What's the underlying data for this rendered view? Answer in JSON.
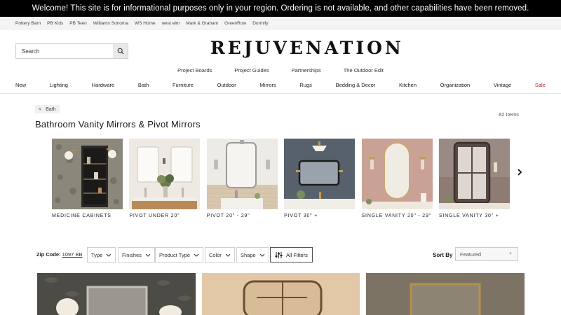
{
  "banner": {
    "text": "Welcome! This site is for informational purposes only in your region. Ordering is not available, and other capabilities have been removed."
  },
  "brands": [
    "Pottery Barn",
    "PB Kids",
    "PB Teen",
    "Williams Sonoma",
    "WS Home",
    "west elm",
    "Mark & Graham",
    "GreenRow",
    "Dormify"
  ],
  "search": {
    "placeholder": "Search",
    "icon": "search-icon"
  },
  "logo": "REJUVENATION",
  "secondary_nav": [
    "Project Boards",
    "Project Guides",
    "Partnerships",
    "The Outdoor Edit"
  ],
  "main_nav": [
    "New",
    "Lighting",
    "Hardware",
    "Bath",
    "Furniture",
    "Outdoor",
    "Mirrors",
    "Rugs",
    "Bedding & Decor",
    "Kitchen",
    "Organization",
    "Vintage",
    "Sale"
  ],
  "breadcrumb": {
    "arrow": "<",
    "label": "Bath"
  },
  "item_count": "82 Items",
  "page_title": "Bathroom Vanity Mirrors & Pivot Mirrors",
  "categories": [
    {
      "label": "MEDICINE CABINETS"
    },
    {
      "label": "PIVOT UNDER 20\""
    },
    {
      "label": "PIVOT 20\" - 29\""
    },
    {
      "label": "PIVOT 30\" +"
    },
    {
      "label": "SINGLE VANITY 20\" - 29\""
    },
    {
      "label": "SINGLE VANITY 30\" +"
    }
  ],
  "filters": {
    "zip_label": "Zip Code:",
    "zip_value": "1097 BB",
    "dropdowns": [
      "Type",
      "Finishes",
      "Product Type",
      "Color",
      "Shape"
    ],
    "all_filters": "All Filters",
    "sort_label": "Sort By",
    "sort_value": "Featured"
  },
  "colors": {
    "sale": "#b3261e",
    "banner_bg": "#000000"
  }
}
